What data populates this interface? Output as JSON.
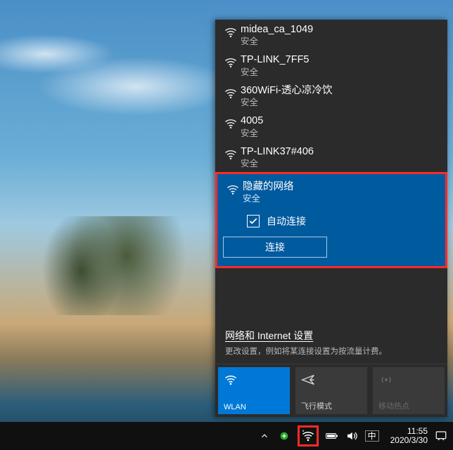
{
  "networks": [
    {
      "ssid": "midea_ca_1049",
      "security": "安全"
    },
    {
      "ssid": "TP-LINK_7FF5",
      "security": "安全"
    },
    {
      "ssid": "360WiFi-透心凉冷饮",
      "security": "安全"
    },
    {
      "ssid": "4005",
      "security": "安全"
    },
    {
      "ssid": "TP-LINK37#406",
      "security": "安全"
    }
  ],
  "selected": {
    "ssid": "隐藏的网络",
    "security": "安全",
    "auto_label": "自动连接",
    "auto_checked": true,
    "connect_label": "连接"
  },
  "settings": {
    "link": "网络和 Internet 设置",
    "desc": "更改设置，例如将某连接设置为按流量计费。"
  },
  "tiles": {
    "wlan": "WLAN",
    "airplane": "飞行模式",
    "hotspot": "移动热点"
  },
  "tray": {
    "ime": "中",
    "time": "11:55",
    "date": "2020/3/30"
  }
}
